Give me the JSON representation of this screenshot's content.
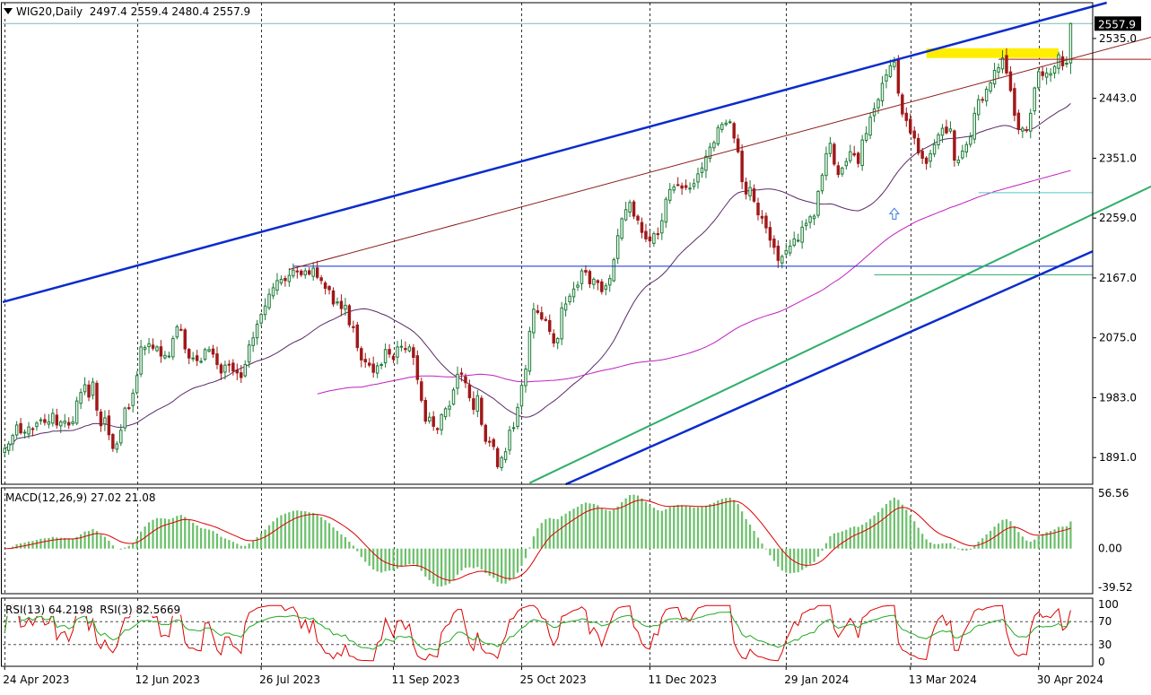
{
  "header": {
    "symbol": "WIG20,Daily",
    "ohlc": "2497.4 2559.4 2480.4 2557.9",
    "menu_icon": "triangle-down-icon"
  },
  "macd_header": {
    "label": "MACD(12,26,9)",
    "values": "27.02 21.08"
  },
  "rsi_header": {
    "label1": "RSI(13) 64.2198",
    "label2": "RSI(3) 82.5669"
  },
  "colors": {
    "up": "#1a7a35",
    "down": "#a01818",
    "channel": "#0a2ccc",
    "outer_channel": "#8b1a1a",
    "uptrend": "#2fae6a",
    "sma_slow": "#c020c0",
    "sma_fast": "#5a2a6a",
    "macd_hist": "#6cc06c",
    "macd_signal": "#dd0000",
    "rsi_fast": "#dd0000",
    "rsi_slow": "#22aa22",
    "support_zone": "#ffee00",
    "current_price_line": "#7fb7b7"
  },
  "chart_data": [
    {
      "type": "candlestick",
      "title": "WIG20,Daily",
      "price_axis": {
        "ylim": [
          1850,
          2590
        ],
        "ticks": [
          "2535.0",
          "2443.0",
          "2351.0",
          "2259.0",
          "2167.0",
          "2075.0",
          "1983.0",
          "1891.0"
        ],
        "current_price": "2557.9"
      },
      "time_axis": {
        "labels": [
          "24 Apr 2023",
          "12 Jun 2023",
          "26 Jul 2023",
          "11 Sep 2023",
          "25 Oct 2023",
          "11 Dec 2023",
          "29 Jan 2024",
          "13 Mar 2024",
          "30 Apr 2024"
        ]
      },
      "grid": true,
      "last_bar": {
        "open": 2497.4,
        "high": 2559.4,
        "low": 2480.4,
        "close": 2557.9
      },
      "closes": [
        1905,
        1912,
        1925,
        1941,
        1929,
        1930,
        1938,
        1935,
        1944,
        1949,
        1945,
        1946,
        1959,
        1941,
        1946,
        1947,
        1941,
        1946,
        1978,
        1991,
        2003,
        1984,
        2007,
        1964,
        1940,
        1952,
        1926,
        1905,
        1912,
        1933,
        1967,
        1967,
        1990,
        2017,
        2061,
        2060,
        2066,
        2059,
        2061,
        2047,
        2048,
        2047,
        2074,
        2092,
        2088,
        2058,
        2044,
        2044,
        2040,
        2039,
        2057,
        2057,
        2050,
        2034,
        2021,
        2033,
        2033,
        2024,
        2021,
        2014,
        2034,
        2064,
        2075,
        2096,
        2111,
        2124,
        2142,
        2152,
        2163,
        2165,
        2163,
        2171,
        2179,
        2177,
        2172,
        2178,
        2173,
        2182,
        2168,
        2163,
        2151,
        2149,
        2127,
        2130,
        2120,
        2125,
        2095,
        2091,
        2060,
        2041,
        2038,
        2033,
        2022,
        2032,
        2034,
        2057,
        2050,
        2042,
        2061,
        2062,
        2057,
        2061,
        2045,
        2011,
        1979,
        1947,
        1953,
        1939,
        1934,
        1957,
        1966,
        1970,
        1995,
        2019,
        2019,
        2006,
        1983,
        1965,
        1986,
        1942,
        1916,
        1915,
        1908,
        1877,
        1891,
        1900,
        1933,
        1937,
        1968,
        2002,
        2027,
        2085,
        2119,
        2114,
        2104,
        2102,
        2085,
        2067,
        2074,
        2121,
        2127,
        2139,
        2150,
        2156,
        2178,
        2176,
        2158,
        2165,
        2160,
        2146,
        2155,
        2166,
        2195,
        2232,
        2258,
        2272,
        2283,
        2262,
        2256,
        2237,
        2227,
        2224,
        2235,
        2234,
        2255,
        2288,
        2303,
        2307,
        2310,
        2305,
        2306,
        2305,
        2312,
        2327,
        2336,
        2354,
        2368,
        2375,
        2398,
        2403,
        2405,
        2407,
        2382,
        2361,
        2315,
        2296,
        2306,
        2285,
        2264,
        2259,
        2244,
        2225,
        2214,
        2194,
        2200,
        2209,
        2216,
        2227,
        2225,
        2245,
        2251,
        2261,
        2262,
        2300,
        2325,
        2358,
        2374,
        2342,
        2326,
        2336,
        2346,
        2361,
        2356,
        2343,
        2379,
        2389,
        2414,
        2427,
        2441,
        2466,
        2479,
        2493,
        2499,
        2451,
        2419,
        2409,
        2390,
        2382,
        2359,
        2351,
        2343,
        2358,
        2372,
        2387,
        2397,
        2390,
        2396,
        2348,
        2348,
        2362,
        2372,
        2384,
        2420,
        2441,
        2440,
        2457,
        2467,
        2486,
        2490,
        2505,
        2482,
        2455,
        2417,
        2395,
        2397,
        2394,
        2420,
        2459,
        2484,
        2478,
        2482,
        2481,
        2492,
        2510,
        2493,
        2497,
        2557.9
      ],
      "overlays": [
        "Moving average 50",
        "Moving average 200",
        "Trend channel",
        "Outer channel",
        "Uptrend line",
        "Support zone"
      ]
    },
    {
      "type": "macd",
      "title": "MACD(12,26,9)",
      "ticks": [
        "56.56",
        "0.00",
        "-39.52"
      ],
      "ylim": [
        -46,
        62
      ],
      "values": [
        27.02,
        21.08
      ]
    },
    {
      "type": "rsi",
      "title": "RSI",
      "ticks": [
        "100",
        "70",
        "30",
        "0"
      ],
      "ylim": [
        0,
        100
      ],
      "series": [
        {
          "name": "RSI(13)",
          "last": 64.2198
        },
        {
          "name": "RSI(3)",
          "last": 82.5669
        }
      ]
    }
  ]
}
